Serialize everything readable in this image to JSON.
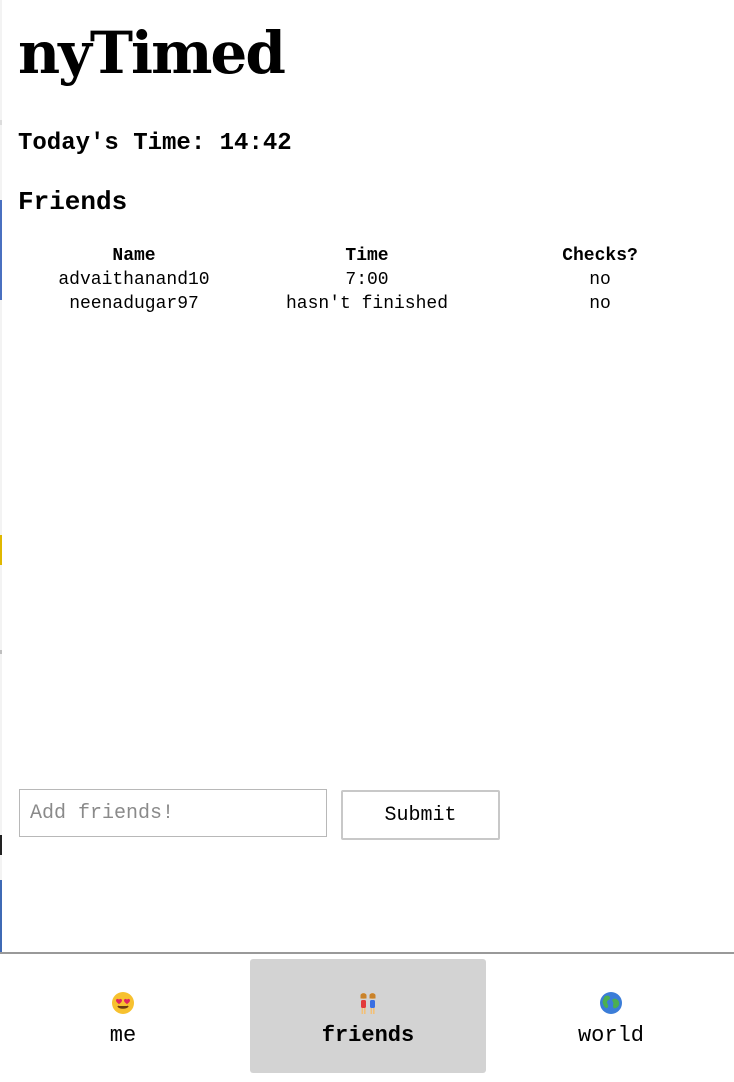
{
  "app": {
    "title": "nyTimed"
  },
  "today": {
    "label": "Today's Time: 14:42"
  },
  "friends": {
    "heading": "Friends",
    "columns": [
      "Name",
      "Time",
      "Checks?"
    ],
    "rows": [
      [
        "advaithanand10",
        "7:00",
        "no"
      ],
      [
        "neenadugar97",
        "hasn't finished",
        "no"
      ]
    ]
  },
  "add_friend": {
    "placeholder": "Add friends!",
    "value": "",
    "submit_label": "Submit"
  },
  "nav": {
    "items": [
      {
        "label": "me",
        "icon": "heart-eyes-emoji-icon",
        "active": false
      },
      {
        "label": "friends",
        "icon": "two-women-emoji-icon",
        "active": true
      },
      {
        "label": "world",
        "icon": "globe-emoji-icon",
        "active": false
      }
    ]
  }
}
